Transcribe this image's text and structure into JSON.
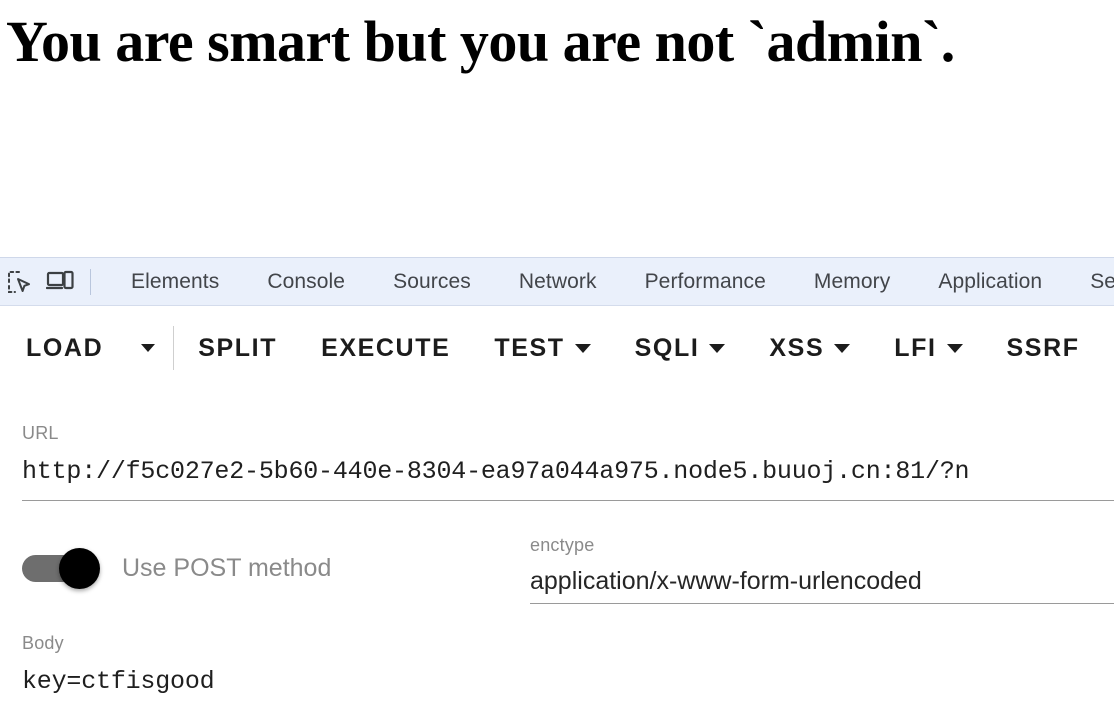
{
  "page": {
    "heading": "You are smart but you are not `admin`."
  },
  "devtools": {
    "icons": [
      {
        "name": "inspect-element-icon",
        "title": "Inspect element"
      },
      {
        "name": "device-toolbar-icon",
        "title": "Toggle device toolbar"
      }
    ],
    "tabs": [
      {
        "label": "Elements"
      },
      {
        "label": "Console"
      },
      {
        "label": "Sources"
      },
      {
        "label": "Network"
      },
      {
        "label": "Performance"
      },
      {
        "label": "Memory"
      },
      {
        "label": "Application"
      },
      {
        "label": "Sec"
      }
    ]
  },
  "toolbar": {
    "load_label": "LOAD",
    "load_caret": "caret-down",
    "split_label": "SPLIT",
    "execute_label": "EXECUTE",
    "test_label": "TEST",
    "sqli_label": "SQLI",
    "xss_label": "XSS",
    "lfi_label": "LFI",
    "ssrf_label": "SSRF"
  },
  "form": {
    "url": {
      "label": "URL",
      "value": "http://f5c027e2-5b60-440e-8304-ea97a044a975.node5.buuoj.cn:81/?n"
    },
    "post_toggle": {
      "label": "Use POST method",
      "state": "on"
    },
    "enctype": {
      "label": "enctype",
      "value": "application/x-www-form-urlencoded"
    },
    "body": {
      "label": "Body",
      "value": "key=ctfisgood"
    }
  },
  "colors": {
    "devtools_bar_bg": "#eaf0fb",
    "devtools_tab_text": "#42454a",
    "toolbar_text": "#1c1c1c",
    "label_grey": "#8a8a8a",
    "value_dark": "#1f1f1f",
    "switch_track": "#6e6e6e",
    "switch_thumb": "#000000",
    "underline": "#9a9a9a",
    "page_bg": "#ffffff"
  }
}
